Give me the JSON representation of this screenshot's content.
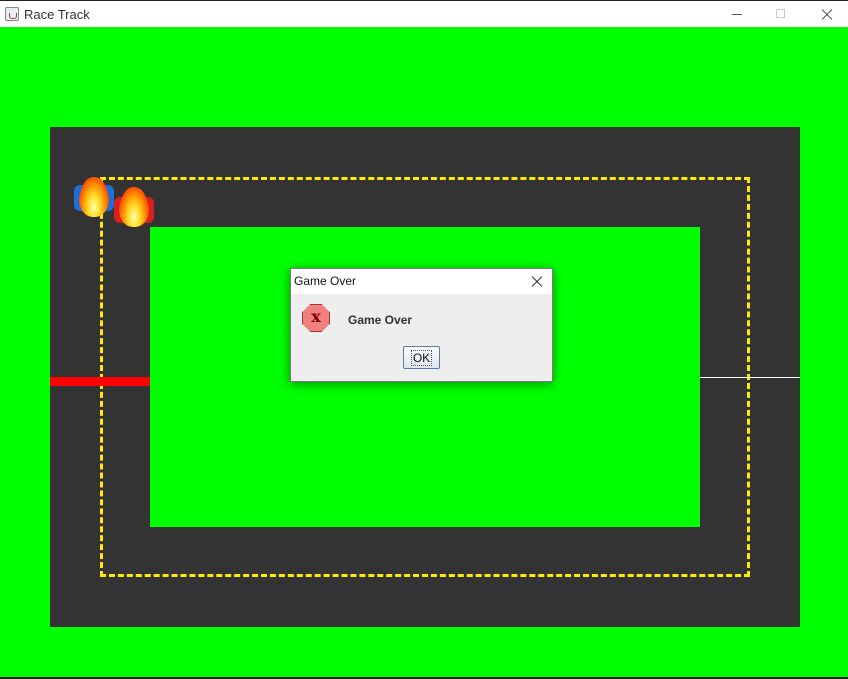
{
  "window": {
    "title": "Race Track",
    "icon": "java-cup-icon"
  },
  "game": {
    "background_color": "#00ff00",
    "track_color": "#333333",
    "lane_line_color": "#ffeb00",
    "start_line_color": "#ff0000",
    "cars": [
      {
        "color": "blue",
        "state": "crashed-on-fire"
      },
      {
        "color": "red",
        "state": "crashed-on-fire"
      }
    ]
  },
  "dialog": {
    "title": "Game Over",
    "message": "Game Over",
    "icon": "error-icon",
    "icon_glyph": "x",
    "ok_label": "OK"
  }
}
